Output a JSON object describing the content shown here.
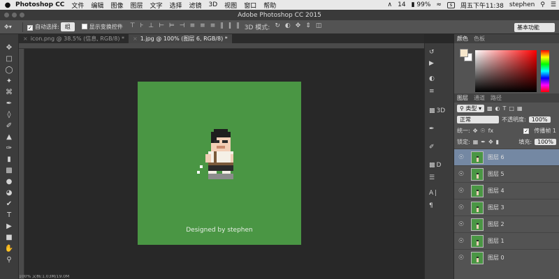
{
  "menubar": {
    "apple_icon": "",
    "app_name": "Photoshop CC",
    "items": [
      "文件",
      "编辑",
      "图像",
      "图层",
      "文字",
      "选择",
      "滤镜",
      "3D",
      "视图",
      "窗口",
      "帮助"
    ],
    "status": {
      "adobe_count": "14",
      "battery": "99%",
      "clock": "周五下午11:38",
      "user": "stephen"
    }
  },
  "titlebar": {
    "title": "Adobe Photoshop CC 2015"
  },
  "options": {
    "auto_select_label": "自动选择:",
    "auto_select_value": "组",
    "transform_label": "显示变换控件",
    "mode_3d_label": "3D 模式:",
    "workspace": "基本功能"
  },
  "tabs": [
    {
      "label": "icon.png @ 38.5% (信息, RGB/8) *",
      "active": false
    },
    {
      "label": "1.jpg @ 100% (图层 6, RGB/8) *",
      "active": true
    }
  ],
  "canvas": {
    "signature": "Designed by stephen",
    "bg_color": "#4a9644"
  },
  "status_bar": {
    "text": "100%    文档:1.03M/19.0M"
  },
  "color_panel": {
    "tabs": [
      "颜色",
      "色板"
    ],
    "fg": "#f5e6cc",
    "bg": "#ffffff"
  },
  "layers_panel": {
    "tabs": [
      "图层",
      "通道",
      "路径"
    ],
    "kind": "类型",
    "blend": "正常",
    "opacity_label": "不透明度:",
    "opacity": "100%",
    "unify_label": "统一:",
    "propagate_label": "传播帧 1",
    "lock_label": "锁定:",
    "fill_label": "填充:",
    "fill": "100%",
    "layers": [
      {
        "name": "图层 6",
        "active": true
      },
      {
        "name": "图层 5",
        "active": false
      },
      {
        "name": "图层 4",
        "active": false
      },
      {
        "name": "图层 3",
        "active": false
      },
      {
        "name": "图层 2",
        "active": false
      },
      {
        "name": "图层 1",
        "active": false
      },
      {
        "name": "图层 0",
        "active": false
      }
    ]
  },
  "dock": {
    "label_3d": "3D",
    "label_a": "A",
    "label_d": "D"
  }
}
